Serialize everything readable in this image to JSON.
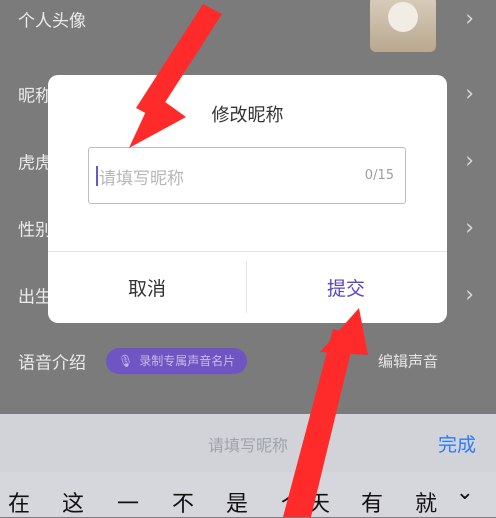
{
  "settings": {
    "rows": [
      {
        "label": "个人头像"
      },
      {
        "label": "昵称"
      },
      {
        "label": "虎虎"
      },
      {
        "label": "性别"
      },
      {
        "label": "出生"
      },
      {
        "label": "语音介绍"
      }
    ],
    "voice_badge": "录制专属声音名片",
    "voice_edit": "编辑声音"
  },
  "dialog": {
    "title": "修改昵称",
    "input_placeholder": "请填写昵称",
    "counter": "0/15",
    "cancel_label": "取消",
    "submit_label": "提交"
  },
  "toolbar": {
    "placeholder": "请填写昵称",
    "done_label": "完成"
  },
  "keyboard": {
    "candidates": [
      "在",
      "这",
      "一",
      "不",
      "是",
      "个",
      "天",
      "有",
      "就"
    ],
    "expand_icon": "chevron-down-icon"
  },
  "annotation": {
    "arrow_color": "#ff2a2a"
  }
}
